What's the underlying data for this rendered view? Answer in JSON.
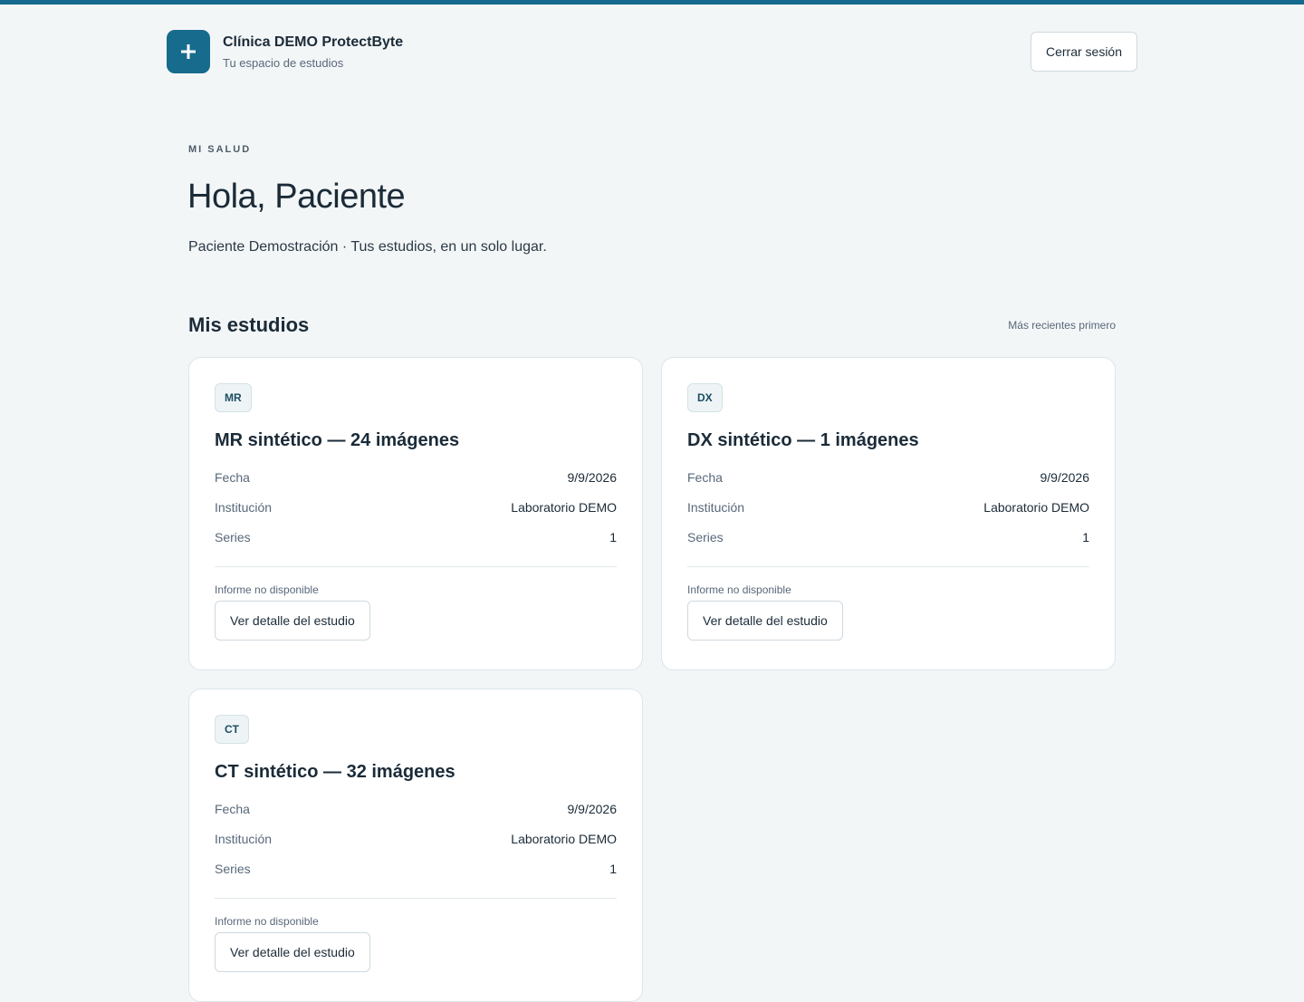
{
  "header": {
    "clinic_name": "Clínica DEMO ProtectByte",
    "clinic_subtitle": "Tu espacio de estudios",
    "logout_label": "Cerrar sesión",
    "accent_color": "#176b8d",
    "logo_icon": "plus-icon"
  },
  "hero": {
    "eyebrow": "MI SALUD",
    "greeting": "Hola, Paciente",
    "subtitle": "Paciente Demostración · Tus estudios, en un solo lugar."
  },
  "studies_section": {
    "title": "Mis estudios",
    "sort_note": "Más recientes primero",
    "studies": [
      {
        "modality": "MR",
        "title": "MR sintético — 24 imágenes",
        "fields": [
          {
            "label": "Fecha",
            "value": "9/9/2026"
          },
          {
            "label": "Institución",
            "value": "Laboratorio DEMO"
          },
          {
            "label": "Series",
            "value": "1"
          }
        ],
        "report_status": "Informe no disponible",
        "detail_label": "Ver detalle del estudio"
      },
      {
        "modality": "DX",
        "title": "DX sintético — 1 imágenes",
        "fields": [
          {
            "label": "Fecha",
            "value": "9/9/2026"
          },
          {
            "label": "Institución",
            "value": "Laboratorio DEMO"
          },
          {
            "label": "Series",
            "value": "1"
          }
        ],
        "report_status": "Informe no disponible",
        "detail_label": "Ver detalle del estudio"
      },
      {
        "modality": "CT",
        "title": "CT sintético — 32 imágenes",
        "fields": [
          {
            "label": "Fecha",
            "value": "9/9/2026"
          },
          {
            "label": "Institución",
            "value": "Laboratorio DEMO"
          },
          {
            "label": "Series",
            "value": "1"
          }
        ],
        "report_status": "Informe no disponible",
        "detail_label": "Ver detalle del estudio"
      }
    ]
  }
}
